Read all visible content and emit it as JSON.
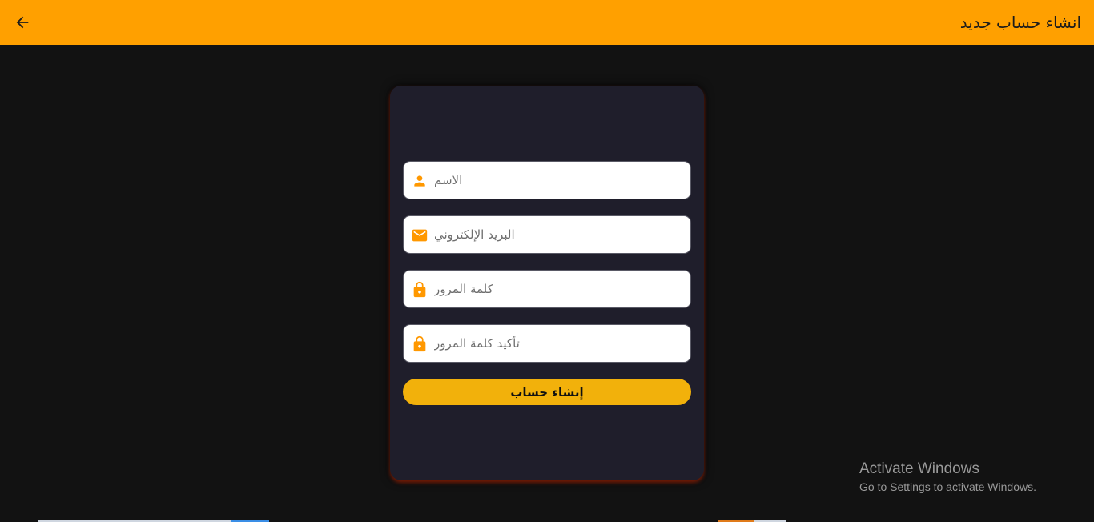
{
  "appbar": {
    "title": "انشاء حساب جديد",
    "back_icon": "arrow-left-icon",
    "color": "#ffa000"
  },
  "form": {
    "fields": [
      {
        "name": "name-field",
        "icon": "person-icon",
        "placeholder": "الاسم",
        "value": ""
      },
      {
        "name": "email-field",
        "icon": "mail-icon",
        "placeholder": "البريد الإلكتروني",
        "value": ""
      },
      {
        "name": "password-field",
        "icon": "lock-icon",
        "placeholder": "كلمة المرور",
        "value": ""
      },
      {
        "name": "confirm-password-field",
        "icon": "lock-icon",
        "placeholder": "تأكيد كلمة المرور",
        "value": ""
      }
    ],
    "submit_label": "إنشاء حساب",
    "accent": "#f2b10b",
    "icon_color": "#ff9800"
  },
  "watermark": {
    "title": "Activate Windows",
    "subtitle": "Go to Settings to activate Windows."
  }
}
